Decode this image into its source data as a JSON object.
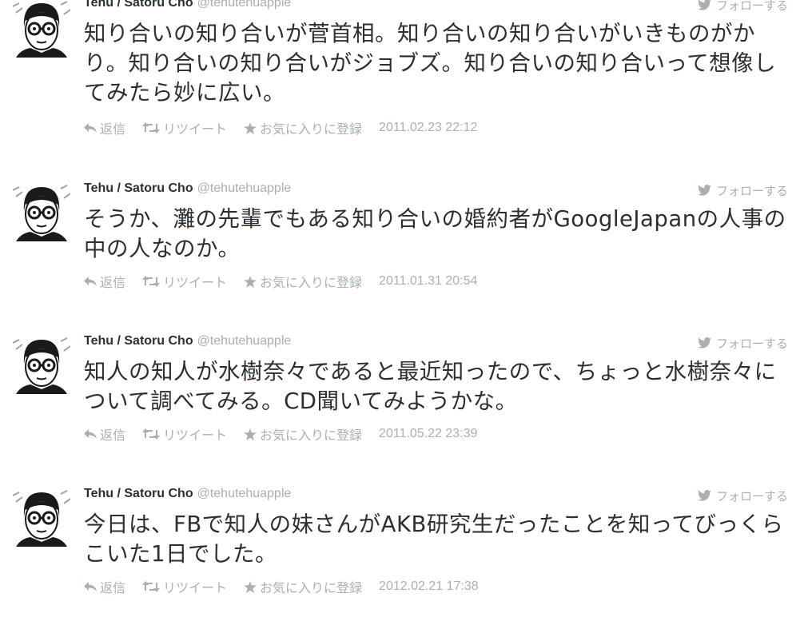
{
  "tweets": [
    {
      "name": "Tehu / Satoru Cho",
      "handle": "@tehutehuapple",
      "follow_label": "フォローする",
      "text": "知り合いの知り合いが菅首相。知り合いの知り合いがいきものがかり。知り合いの知り合いがジョブズ。知り合いの知り合いって想像してみたら妙に広い。",
      "actions": {
        "reply": "返信",
        "retweet": "リツイート",
        "favorite": "お気に入りに登録"
      },
      "date": "2011.02.23 22:12"
    },
    {
      "name": "Tehu / Satoru Cho",
      "handle": "@tehutehuapple",
      "follow_label": "フォローする",
      "text": "そうか、灘の先輩でもある知り合いの婚約者がGoogleJapanの人事の中の人なのか。",
      "actions": {
        "reply": "返信",
        "retweet": "リツイート",
        "favorite": "お気に入りに登録"
      },
      "date": "2011.01.31 20:54"
    },
    {
      "name": "Tehu / Satoru Cho",
      "handle": "@tehutehuapple",
      "follow_label": "フォローする",
      "text": "知人の知人が水樹奈々であると最近知ったので、ちょっと水樹奈々について調べてみる。CD聞いてみようかな。",
      "actions": {
        "reply": "返信",
        "retweet": "リツイート",
        "favorite": "お気に入りに登録"
      },
      "date": "2011.05.22 23:39"
    },
    {
      "name": "Tehu / Satoru Cho",
      "handle": "@tehutehuapple",
      "follow_label": "フォローする",
      "text": "今日は、FBで知人の妹さんがAKB研究生だったことを知ってびっくらこいた1日でした。",
      "actions": {
        "reply": "返信",
        "retweet": "リツイート",
        "favorite": "お気に入りに登録"
      },
      "date": "2012.02.21 17:38"
    }
  ],
  "icons": {
    "avatar": "avatar-illustration",
    "follow": "twitter-bird-icon",
    "reply": "reply-arrow-icon",
    "retweet": "retweet-icon",
    "favorite": "star-icon"
  },
  "colors": {
    "text": "#292f33",
    "muted": "#a9b0b5",
    "background": "#ffffff"
  }
}
